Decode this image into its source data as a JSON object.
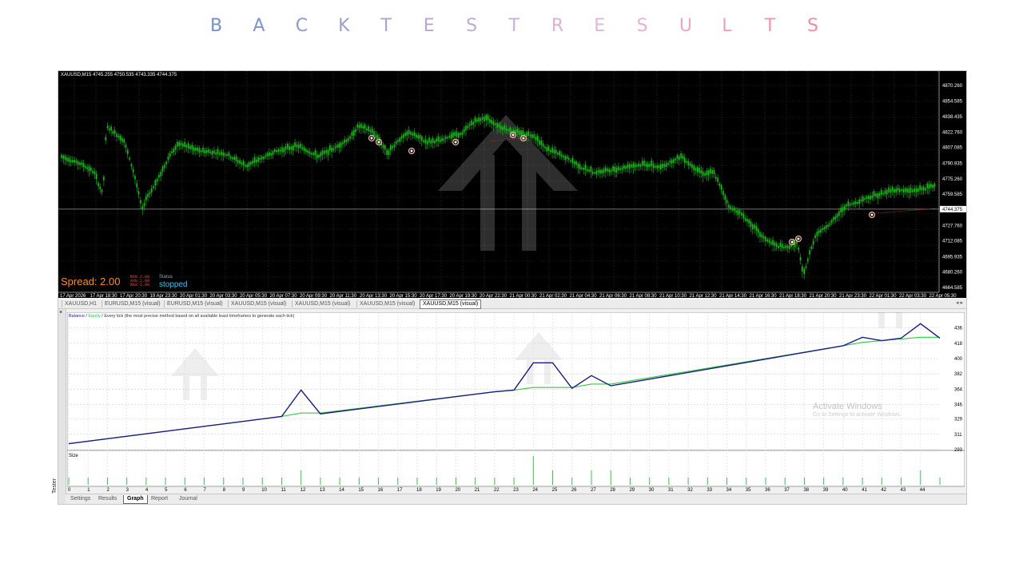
{
  "page_title": "BACKTESTRESULTS",
  "title_gradient": [
    "#6f8fd6",
    "#b1a7d3",
    "#eab5dc",
    "#f68aa1"
  ],
  "chart": {
    "symbol_info": "XAUUSD,M15  4745.255 4750.535 4743.335 4744.375",
    "spread_label": "Spread: 2.00",
    "spread_mini": [
      "MIN 2.00",
      "AVG 2.00",
      "MAX 2.00"
    ],
    "status_label": "Status",
    "status_value": "stopped",
    "price_ticks": [
      "4870.260",
      "4854.585",
      "4838.435",
      "4822.760",
      "4807.085",
      "4790.935",
      "4775.260",
      "4759.585",
      "4744.375",
      "4727.760",
      "4712.085",
      "4695.935",
      "4680.260",
      "4664.585"
    ],
    "current_price": "4744.375",
    "time_ticks": [
      "17 Apr 2026",
      "17 Apr 18:30",
      "17 Apr 20:30",
      "19 Apr 23:30",
      "20 Apr 01:30",
      "20 Apr 03:30",
      "20 Apr 05:30",
      "20 Apr 07:30",
      "20 Apr 09:30",
      "20 Apr 11:30",
      "20 Apr 13:30",
      "20 Apr 15:30",
      "20 Apr 17:30",
      "20 Apr 19:30",
      "20 Apr 22:30",
      "21 Apr 00:30",
      "21 Apr 02:30",
      "21 Apr 04:30",
      "21 Apr 06:30",
      "21 Apr 08:30",
      "21 Apr 10:30",
      "21 Apr 12:30",
      "21 Apr 14:30",
      "21 Apr 16:30",
      "21 Apr 18:30",
      "21 Apr 20:30",
      "21 Apr 23:30",
      "22 Apr 01:30",
      "22 Apr 03:30",
      "22 Apr 05:30"
    ],
    "candle_color": "#00d000",
    "grid_color": "#3a3a3a"
  },
  "symbol_tabs": [
    "XAUUSD,H1",
    "EURUSD,M15 (visual)",
    "EURUSD,M15 (visual)",
    "XAUUSD,M15 (visual)",
    "XAUUSD,M15 (visual)",
    "XAUUSD,M15 (visual)",
    "XAUUSD,M15 (visual)"
  ],
  "active_symbol_tab": 6,
  "tester": {
    "label": "Tester",
    "close": "×",
    "legend_balance": "Balance",
    "legend_sep": " / ",
    "legend_equity": "Equity",
    "legend_rest": " / Every tick (the most precise method based on all available least timeframes to generate each tick)",
    "size_label": "Size",
    "balance_color": "#1a1a8c",
    "equity_color": "#2ecc40"
  },
  "chart_data": {
    "type": "line",
    "title": "",
    "xlabel": "",
    "ylabel": "",
    "x": [
      0,
      11,
      12,
      13,
      22,
      23,
      24,
      25,
      26,
      27,
      28,
      40,
      41,
      42,
      43,
      44,
      45
    ],
    "series": [
      {
        "name": "Balance",
        "values": [
          300,
          332,
          363,
          335,
          361,
          363,
          395,
          395,
          365,
          380,
          368,
          415,
          425,
          421,
          424,
          441,
          424
        ]
      },
      {
        "name": "Equity",
        "values": [
          300,
          332,
          336,
          336,
          361,
          363,
          366,
          366,
          366,
          370,
          370,
          415,
          419,
          421,
          423,
          425,
          425
        ]
      }
    ],
    "size_values": [
      1,
      1,
      1,
      1,
      1,
      1,
      1,
      1,
      1,
      1,
      1,
      1,
      2,
      1,
      1,
      1,
      1,
      1,
      1,
      1,
      1,
      1,
      1,
      1,
      4,
      2,
      1,
      2,
      2,
      1,
      1,
      1,
      1,
      1,
      1,
      1,
      1,
      1,
      1,
      1,
      1,
      1,
      1,
      1,
      2,
      1
    ],
    "ylim": [
      293,
      445
    ],
    "y_ticks": [
      "436",
      "418",
      "400",
      "382",
      "364",
      "346",
      "329",
      "311",
      "293"
    ],
    "x_ticks": [
      "0",
      "1",
      "2",
      "3",
      "4",
      "5",
      "6",
      "7",
      "8",
      "9",
      "10",
      "11",
      "12",
      "13",
      "14",
      "15",
      "16",
      "17",
      "18",
      "19",
      "20",
      "21",
      "22",
      "23",
      "24",
      "25",
      "26",
      "27",
      "28",
      "29",
      "30",
      "31",
      "32",
      "33",
      "34",
      "35",
      "36",
      "37",
      "38",
      "39",
      "40",
      "41",
      "42",
      "43",
      "44"
    ],
    "grid": true
  },
  "bottom_tabs": [
    "Settings",
    "Results",
    "Graph",
    "Report",
    "Journal"
  ],
  "active_bottom_tab": 2,
  "watermark": {
    "line1": "Activate Windows",
    "line2": "Go to Settings to activate Windows."
  }
}
